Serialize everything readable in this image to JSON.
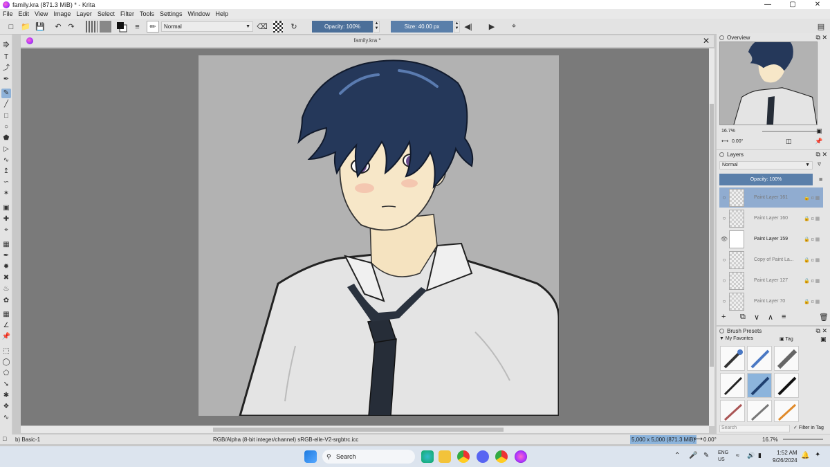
{
  "window": {
    "title": "family.kra (871.3 MiB)  * - Krita",
    "minimize": "—",
    "maximize": "▢",
    "close": "✕"
  },
  "menu": [
    "File",
    "Edit",
    "View",
    "Image",
    "Layer",
    "Select",
    "Filter",
    "Tools",
    "Settings",
    "Window",
    "Help"
  ],
  "toolbar": {
    "blend_mode": "Normal",
    "opacity_label": "Opacity: 100%",
    "opacity_value": 1.0,
    "size_label": "Size: 40.00 px",
    "size_value": 40.0
  },
  "document": {
    "tab_title": "family.kra *"
  },
  "overview": {
    "title": "Overview",
    "zoom": "16.7%",
    "rotation": "0.00°"
  },
  "layers": {
    "title": "Layers",
    "blend_mode": "Normal",
    "opacity_label": "Opacity:  100%",
    "items": [
      {
        "name": "Paint Layer 161",
        "selected": true,
        "visible": false
      },
      {
        "name": "Paint Layer 160",
        "selected": false,
        "visible": false
      },
      {
        "name": "Paint Layer 159",
        "selected": false,
        "visible": true
      },
      {
        "name": "Copy of Paint La...",
        "selected": false,
        "visible": false
      },
      {
        "name": "Paint Layer 127",
        "selected": false,
        "visible": false
      },
      {
        "name": "Paint Layer 70",
        "selected": false,
        "visible": false
      }
    ]
  },
  "brush_presets": {
    "title": "Brush Presets",
    "tag": "My Favorites",
    "tag_button": "Tag",
    "search_placeholder": "Search",
    "filter_in_tag": "Filter in Tag"
  },
  "status": {
    "brush": "b) Basic-1",
    "color_info": "RGB/Alpha (8-bit integer/channel)  sRGB-elle-V2-srgbtrc.icc",
    "dimensions": "5,000 x 5,000 (871.3 MiB)",
    "rotation": "0.00°",
    "zoom": "16.7%"
  },
  "taskbar": {
    "search": "Search",
    "lang_top": "ENG",
    "lang_bottom": "US",
    "time": "1:52 AM",
    "date": "9/26/2024"
  },
  "colors": {
    "accent": "#5a7faa",
    "selection": "#90acd0",
    "hair": "#25385a",
    "shirt": "#e6e6e6",
    "tie": "#252d38",
    "skin": "#f7e7c8",
    "eye": "#6a4a8c"
  }
}
